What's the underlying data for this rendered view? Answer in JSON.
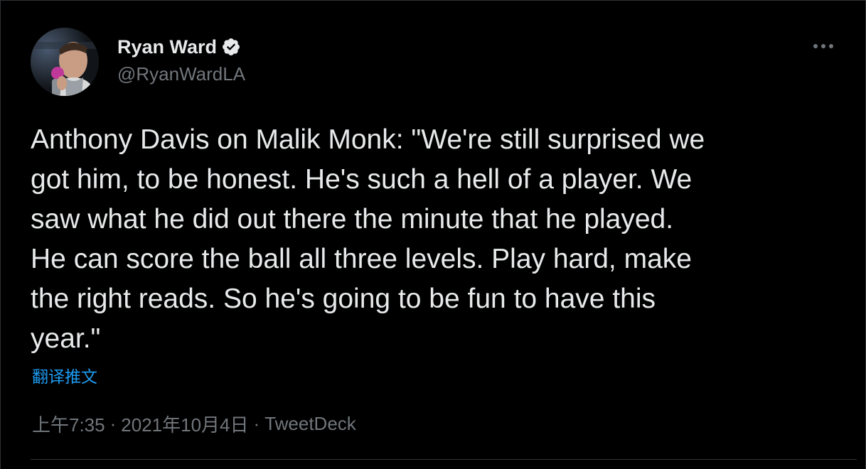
{
  "tweet": {
    "author": {
      "display_name": "Ryan Ward",
      "handle": "@RyanWardLA",
      "verified": true,
      "avatar_icon": "user-avatar-photo"
    },
    "text": "Anthony Davis on Malik Monk: \"We're still surprised we\ngot him, to be honest. He's such a hell of a player. We\nsaw what he did out there the minute that he played.\nHe can score the ball all three levels. Play hard, make\nthe right reads. So he's going to be fun to have this\nyear.\"",
    "translate_label": "翻译推文",
    "time": "上午7:35",
    "separator": "·",
    "date": "2021年10月4日",
    "source": "TweetDeck",
    "more_icon": "more-horizontal-icon"
  },
  "colors": {
    "background": "#000000",
    "text_primary": "#e7e9ea",
    "text_secondary": "#71767b",
    "link": "#1d9bf0",
    "verified_badge": "#e7e9ea"
  }
}
